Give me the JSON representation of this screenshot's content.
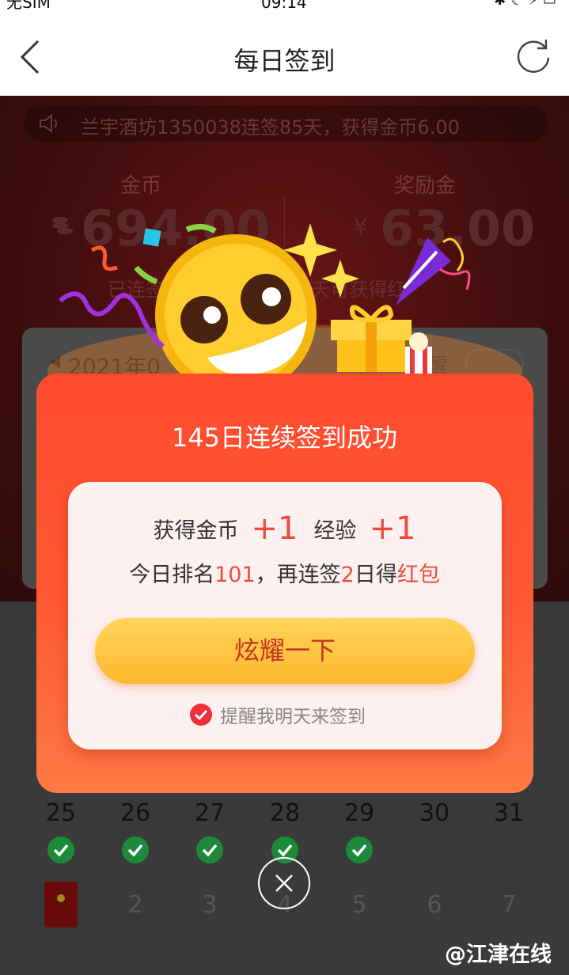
{
  "status_bar": {
    "carrier": "无SIM",
    "time": "09:14"
  },
  "nav": {
    "title": "每日签到"
  },
  "notice": {
    "text": "兰宇酒坊1350038连签85天，获得金币6.00"
  },
  "stats": {
    "coins_label": "金币",
    "coins_value": "694.00",
    "bonus_label": "奖励金",
    "bonus_currency": "¥",
    "bonus_value": "63.00",
    "streak_partial": "已连签",
    "bonus_partial": "2天可获得红"
  },
  "calendar": {
    "month_label": "2021年0",
    "remind_partial": "醒",
    "days_row": [
      "25",
      "26",
      "27",
      "28",
      "29",
      "30",
      "31"
    ],
    "checked_count": 5,
    "next_row": [
      "2",
      "3",
      "4",
      "5",
      "6",
      "7"
    ]
  },
  "modal": {
    "title": "145日连续签到成功",
    "coin_label": "获得金币",
    "coin_value": "+1",
    "exp_label": "经验",
    "exp_value": "+1",
    "rank_prefix": "今日排名",
    "rank_value": "101",
    "rank_middle": "，再连签",
    "rank_days": "2",
    "rank_suffix": "日得",
    "rank_reward": "红包",
    "share_button": "炫耀一下",
    "remind_text": "提醒我明天来签到"
  },
  "watermark": "@江津在线",
  "colors": {
    "modal_red": "#ff4a2e",
    "accent_red": "#f04a3a",
    "button_yellow": "#ffb72e",
    "check_green": "#1c8a3a"
  }
}
